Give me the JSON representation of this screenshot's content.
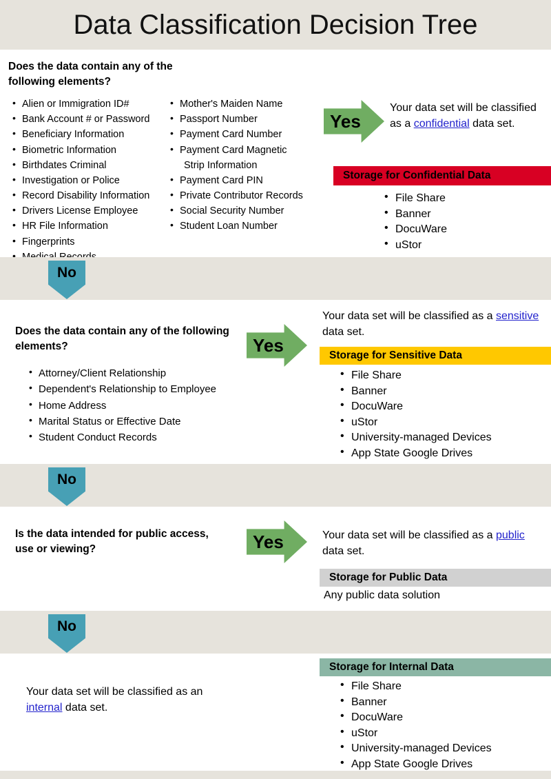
{
  "header": {
    "title": "Data Classification Decision Tree"
  },
  "colors": {
    "header_band": "#e6e3dc",
    "yes_arrow": "#70ad62",
    "no_arrow": "#47a0b5",
    "confidential_banner": "#d80023",
    "sensitive_banner": "#ffc800",
    "public_banner": "#d1d1d1",
    "internal_banner": "#8bb6a5",
    "link": "#2222cc"
  },
  "sections": {
    "confidential": {
      "question": "Does the data contain any of the following elements?",
      "yes_label": "Yes",
      "no_label": "No",
      "elements_column_1": [
        "Alien or Immigration ID#",
        "Bank Account # or Password",
        "Beneficiary Information",
        "Biometric Information",
        "Birthdates Criminal",
        "Investigation or Police",
        "Record Disability Information",
        "Drivers License Employee",
        "HR File Information",
        "Fingerprints",
        "Medical Records"
      ],
      "elements_column_2": [
        "Mother's Maiden Name",
        "Passport Number",
        "Payment Card Number",
        "Payment Card Magnetic",
        "Strip Information",
        "Payment Card PIN",
        "Private Contributor Records",
        "Social Security Number",
        "Student Loan Number"
      ],
      "result_prefix": "Your data set will be classified as a ",
      "result_link": "confidential",
      "result_suffix": " data set.",
      "storage_title": "Storage for Confidential Data",
      "storage_items": [
        "File Share",
        "Banner",
        "DocuWare",
        "uStor"
      ]
    },
    "sensitive": {
      "question": "Does the data contain any of the following elements?",
      "yes_label": "Yes",
      "no_label": "No",
      "elements": [
        "Attorney/Client Relationship",
        "Dependent's Relationship to Employee",
        "Home Address",
        "Marital Status or Effective Date",
        "Student Conduct Records"
      ],
      "result_prefix": "Your data set will be classified as a ",
      "result_link": "sensitive",
      "result_suffix": " data set.",
      "storage_title": "Storage for Sensitive Data",
      "storage_items": [
        "File Share",
        "Banner",
        "DocuWare",
        "uStor",
        "University-managed Devices",
        "App State Google Drives"
      ]
    },
    "public": {
      "question": "Is the data intended for public access, use or viewing?",
      "yes_label": "Yes",
      "no_label": "No",
      "result_prefix": "Your data set will be classified as a ",
      "result_link": "public",
      "result_suffix": " data set.",
      "storage_title": "Storage for Public Data",
      "storage_note": "Any public data solution"
    },
    "internal": {
      "result_prefix": "Your data set will be classified as an ",
      "result_link": "internal",
      "result_suffix": " data set.",
      "storage_title": "Storage for Internal Data",
      "storage_items": [
        "File Share",
        "Banner",
        "DocuWare",
        "uStor",
        "University-managed Devices",
        "App State Google Drives"
      ]
    }
  }
}
